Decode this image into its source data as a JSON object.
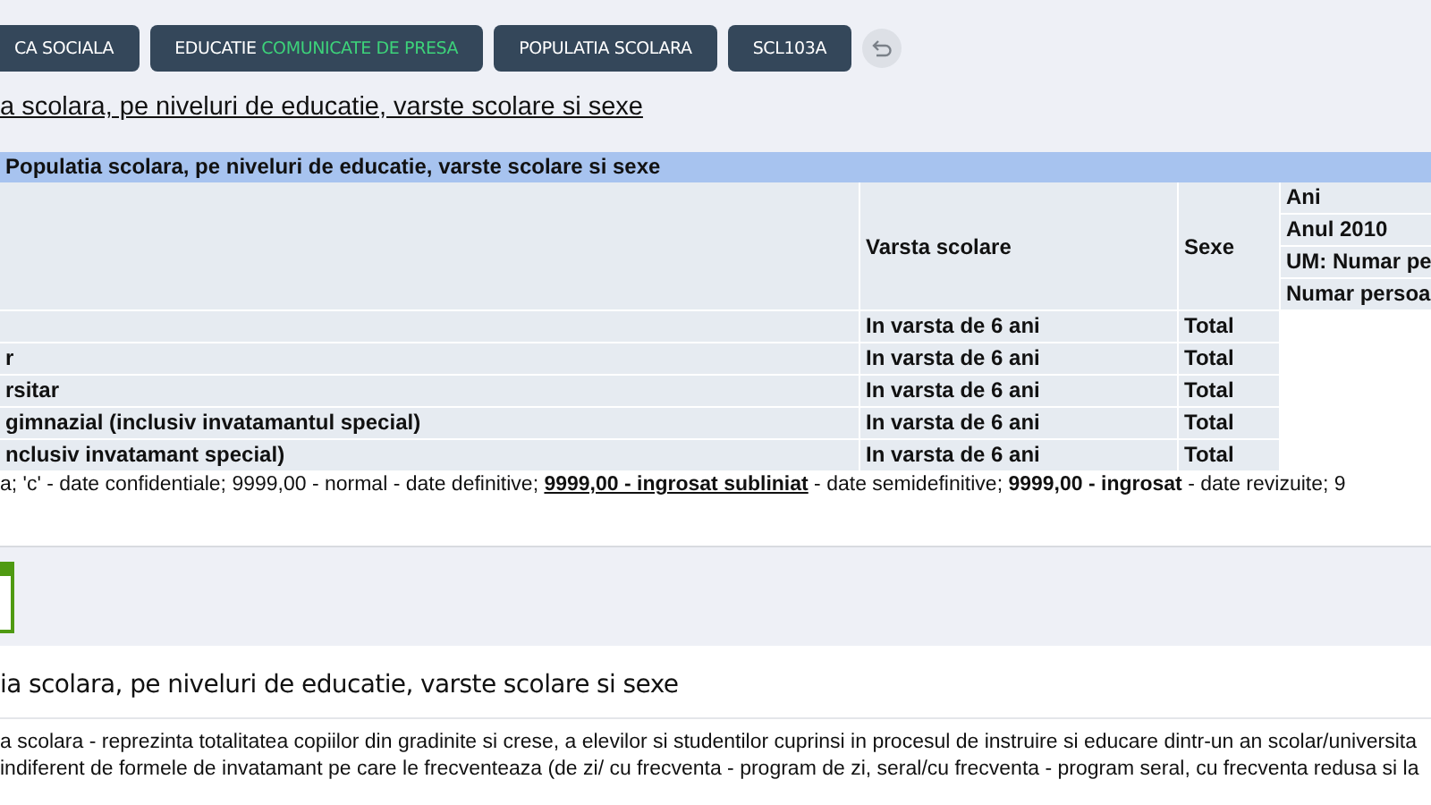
{
  "breadcrumbs": [
    {
      "label": "CA SOCIALA"
    },
    {
      "label": "EDUCATIE",
      "sublabel": "COMUNICATE DE PRESA"
    },
    {
      "label": "POPULATIA SCOLARA"
    },
    {
      "label": "SCL103A"
    }
  ],
  "page_title": "a scolara, pe niveluri de educatie, varste scolare si sexe",
  "table": {
    "caption": "Populatia scolara, pe niveluri de educatie, varste scolare si sexe",
    "columns": [
      {
        "label": "Varsta scolare"
      },
      {
        "label": "Sexe"
      }
    ],
    "column_4_headers": [
      "Ani",
      "Anul 2010",
      "UM: Numar pe",
      "Numar persoa"
    ],
    "rows": [
      {
        "age": "In varsta de 6 ani",
        "sex": "Total"
      },
      {
        "column_1": "r",
        "age": "In varsta de 6 ani",
        "sex": "Total"
      },
      {
        "column_1": "rsitar",
        "age": "In varsta de 6 ani",
        "sex": "Total"
      },
      {
        "column_1": "gimnazial (inclusiv invatamantul special)",
        "age": "In varsta de 6 ani",
        "sex": "Total"
      },
      {
        "column_1": "nclusiv invatamant special)",
        "age": "In varsta de 6 ani",
        "sex": "Total"
      }
    ],
    "legend": [
      {
        "text": "a; 'c' - date confidentiale; 9999,00 - normal - date definitive; ",
        "kind": "plain"
      },
      {
        "text": "9999,00 - ingrosat subliniat",
        "kind": "emphasis"
      },
      {
        "text": " - date semidefinitive; ",
        "kind": "plain"
      },
      {
        "text": "9999,00 - ingrosat",
        "kind": "strong"
      },
      {
        "text": " - date revizuite; 9",
        "kind": "plain"
      }
    ]
  },
  "description": {
    "title": "ia scolara, pe niveluri de educatie, varste scolare si sexe",
    "lines": [
      "a scolara - reprezinta totalitatea copiilor din gradinite si crese, a elevilor si studentilor cuprinsi in procesul de instruire si educare dintr-un an scolar/universita",
      "indiferent de formele de invatamant pe care le frecventeaza (de zi/ cu frecventa - program de zi, seral/cu frecventa - program seral, cu frecventa redusa si la"
    ]
  }
}
